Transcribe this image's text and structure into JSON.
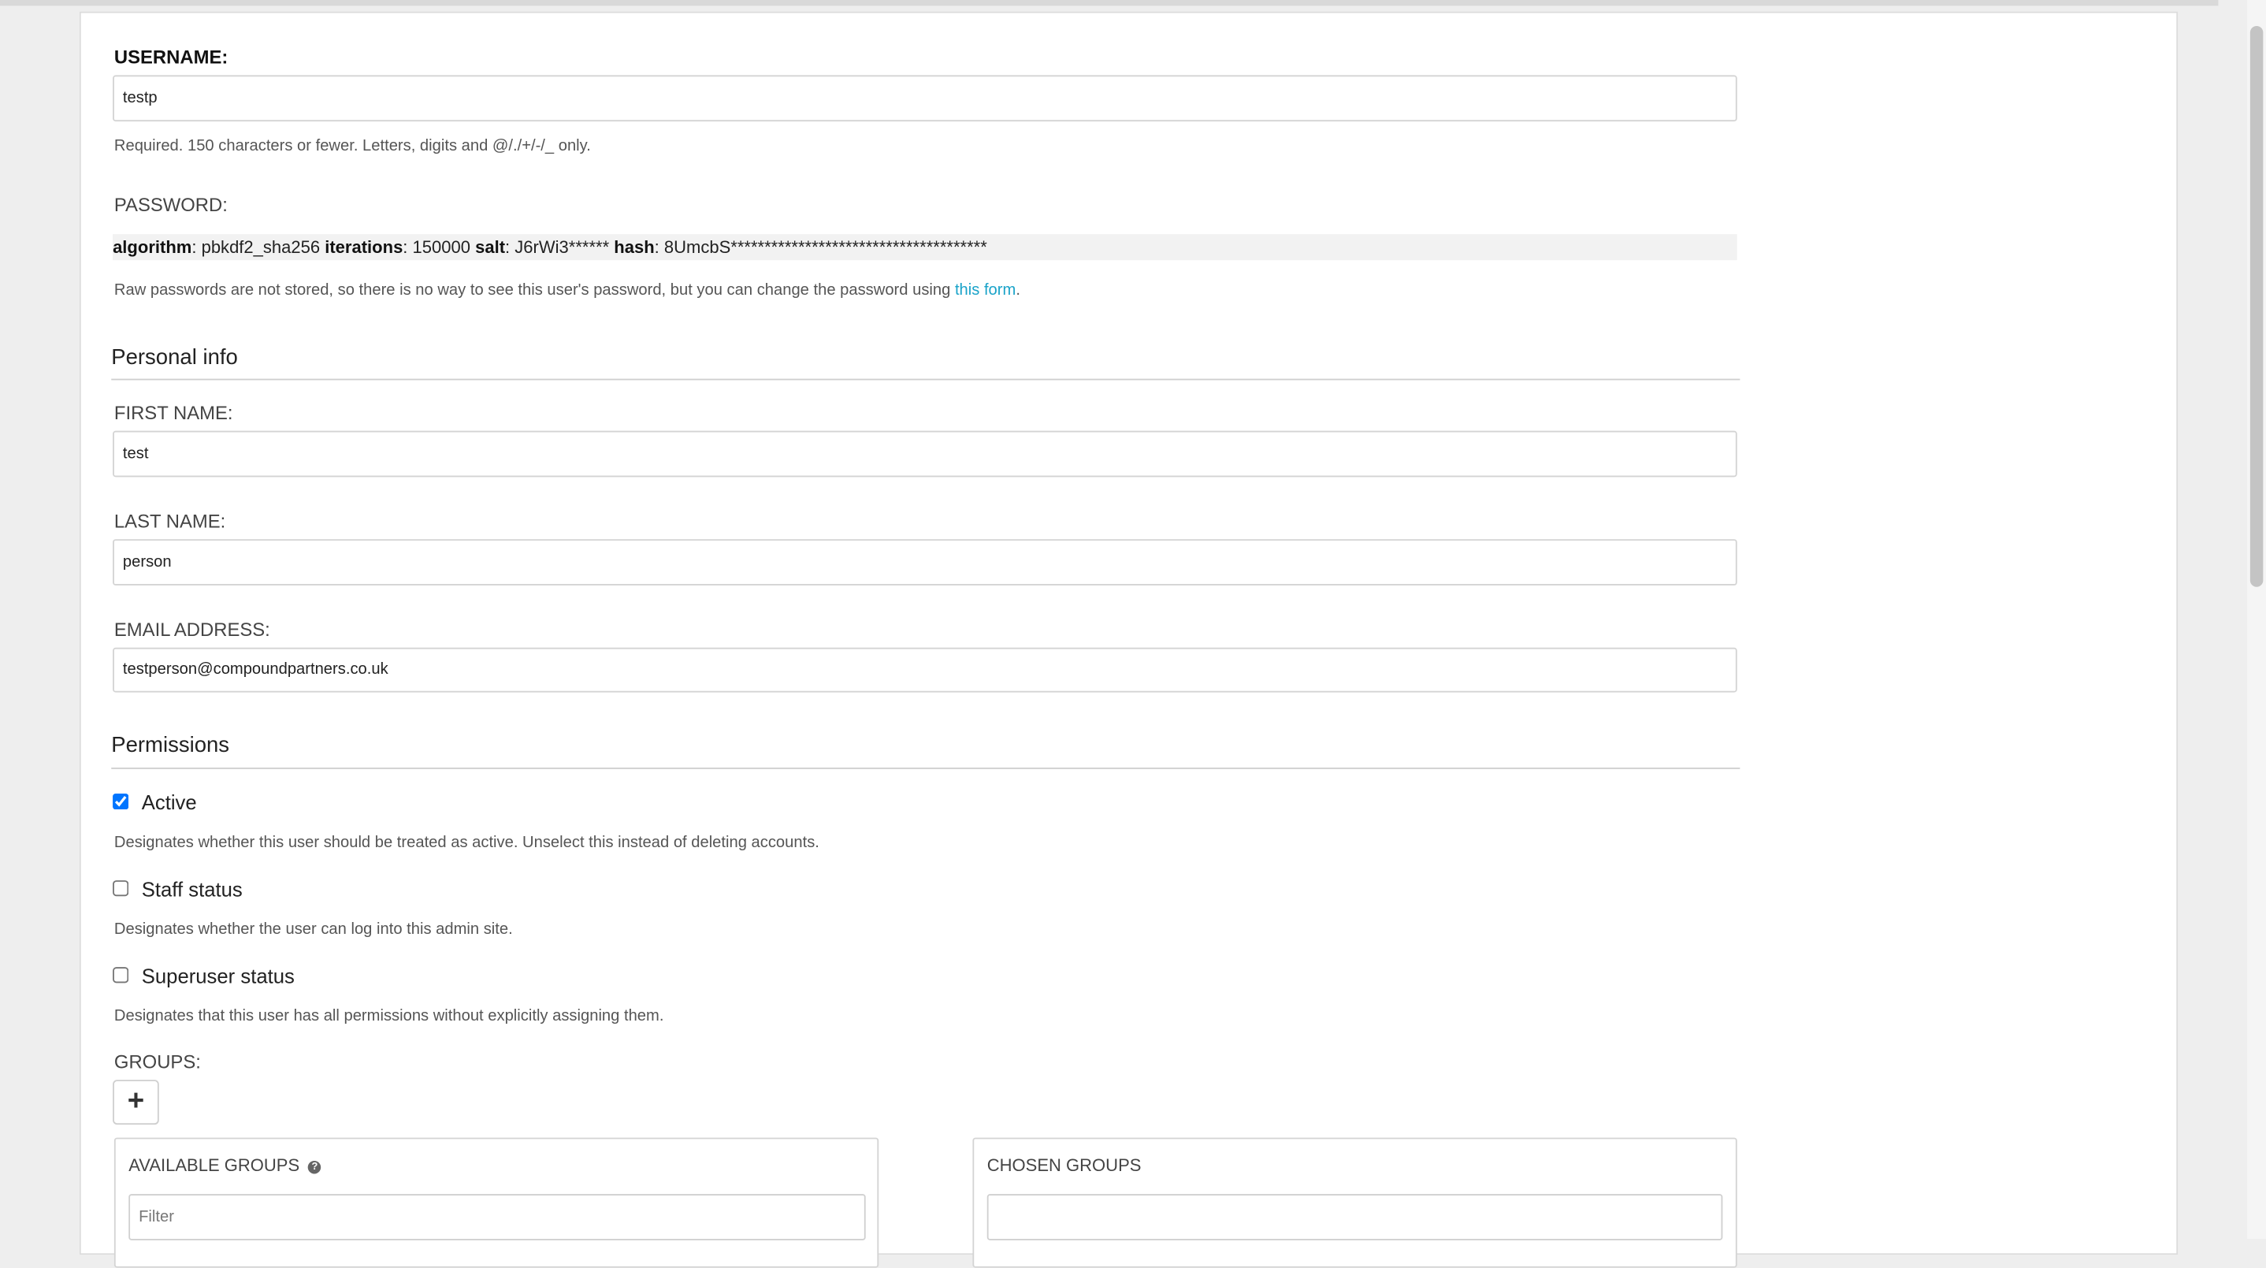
{
  "username": {
    "label": "USERNAME:",
    "value": "testp",
    "help": "Required. 150 characters or fewer. Letters, digits and @/./+/-/_ only."
  },
  "password": {
    "label": "PASSWORD:",
    "algorithm_label": "algorithm",
    "algorithm_value": ": pbkdf2_sha256 ",
    "iterations_label": "iterations",
    "iterations_value": ": 150000 ",
    "salt_label": "salt",
    "salt_value": ": J6rWi3****** ",
    "hash_label": "hash",
    "hash_value": ": 8UmcbS**************************************",
    "help_prefix": "Raw passwords are not stored, so there is no way to see this user's password, but you can change the password using ",
    "help_link": "this form",
    "help_suffix": "."
  },
  "personal_info": {
    "title": "Personal info",
    "first_name_label": "FIRST NAME:",
    "first_name_value": "test",
    "last_name_label": "LAST NAME:",
    "last_name_value": "person",
    "email_label": "EMAIL ADDRESS:",
    "email_value": "testperson@compoundpartners.co.uk"
  },
  "permissions": {
    "title": "Permissions",
    "active_label": "Active",
    "active_checked": true,
    "active_help": "Designates whether this user should be treated as active. Unselect this instead of deleting accounts.",
    "staff_label": "Staff status",
    "staff_checked": false,
    "staff_help": "Designates whether the user can log into this admin site.",
    "superuser_label": "Superuser status",
    "superuser_checked": false,
    "superuser_help": "Designates that this user has all permissions without explicitly assigning them."
  },
  "groups": {
    "label": "GROUPS:",
    "add_button": "+",
    "available_title": "AVAILABLE GROUPS",
    "help_icon": "?",
    "filter_placeholder": "Filter",
    "chosen_title": "CHOSEN GROUPS"
  }
}
